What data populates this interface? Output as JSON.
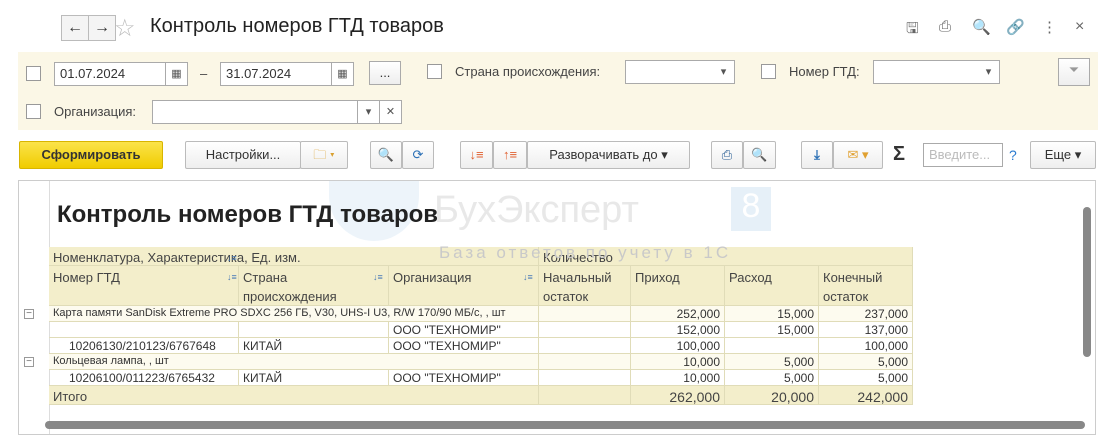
{
  "window": {
    "title": "Контроль номеров ГТД товаров",
    "back_icon": "←",
    "forward_icon": "→",
    "close": "×"
  },
  "filter": {
    "date_from": "01.07.2024",
    "date_to": "31.07.2024",
    "dash": "–",
    "period_button": "...",
    "country_label": "Страна происхождения:",
    "country_value": "",
    "gtd_label": "Номер ГТД:",
    "gtd_value": "",
    "org_label": "Организация:",
    "org_value": ""
  },
  "toolbar": {
    "generate": "Сформировать",
    "settings": "Настройки...",
    "expand": "Разворачивать до",
    "search_placeholder": "Введите...",
    "help": "?",
    "more": "Еще",
    "sigma": "Σ"
  },
  "watermark": {
    "brand": "БухЭксперт",
    "version": "8",
    "subtitle": "База ответов по учету в 1С"
  },
  "report": {
    "title": "Контроль номеров ГТД товаров",
    "header1": [
      "Номенклатура, Характеристика, Ед. изм.",
      "Количество"
    ],
    "header2": [
      "Номер ГТД",
      "Страна происхождения",
      "Организация",
      "Начальный остаток",
      "Приход",
      "Расход",
      "Конечный остаток"
    ],
    "rows": [
      {
        "type": "group",
        "name": "Карта памяти SanDisk Extreme PRO SDXC 256 ГБ, V30, UHS-I U3, R/W 170/90 МБ/с, , шт",
        "start": "",
        "in": "252,000",
        "out": "15,000",
        "end": "237,000"
      },
      {
        "type": "detail",
        "gtd": "",
        "country": "",
        "org": "ООО \"ТЕХНОМИР\"",
        "start": "",
        "in": "152,000",
        "out": "15,000",
        "end": "137,000"
      },
      {
        "type": "detail",
        "gtd": "10206130/210123/6767648",
        "country": "КИТАЙ",
        "org": "ООО \"ТЕХНОМИР\"",
        "start": "",
        "in": "100,000",
        "out": "",
        "end": "100,000"
      },
      {
        "type": "group",
        "name": "Кольцевая лампа, , шт",
        "start": "",
        "in": "10,000",
        "out": "5,000",
        "end": "5,000"
      },
      {
        "type": "detail",
        "gtd": "10206100/011223/6765432",
        "country": "КИТАЙ",
        "org": "ООО \"ТЕХНОМИР\"",
        "start": "",
        "in": "10,000",
        "out": "5,000",
        "end": "5,000"
      }
    ],
    "total": {
      "label": "Итого",
      "start": "",
      "in": "262,000",
      "out": "20,000",
      "end": "242,000"
    }
  }
}
